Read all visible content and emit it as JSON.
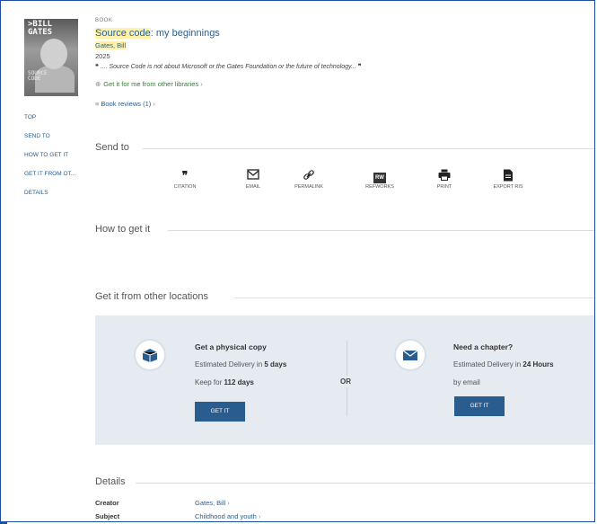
{
  "record": {
    "type": "BOOK",
    "title_hl": "Source code",
    "title_rest": ": my beginnings",
    "author": "Gates, Bill",
    "year": "2025",
    "quote_mark_open": "❝",
    "quote_text": ".... Source Code is not about Microsoft or the Gates Foundation or the future of technology...",
    "quote_mark_close": "❞",
    "get_it_link": "Get it for me from other libraries",
    "reviews_link": "Book reviews (1)",
    "chevron": "›",
    "cover_title": ">BILL\nGATES",
    "cover_subtitle": "SOURCE\nCODE"
  },
  "nav": {
    "items": [
      "TOP",
      "SEND TO",
      "HOW TO GET IT",
      "GET IT FROM OT...",
      "DETAILS"
    ]
  },
  "sections": {
    "send_to": "Send to",
    "how_to_get": "How to get it",
    "other_locations": "Get it from other locations",
    "details": "Details"
  },
  "actions": [
    {
      "label": "CITATION",
      "icon": "quote-icon",
      "glyph": "❞"
    },
    {
      "label": "EMAIL",
      "icon": "email-icon",
      "glyph": "✉"
    },
    {
      "label": "PERMALINK",
      "icon": "link-icon",
      "glyph": "🔗"
    },
    {
      "label": "REFWORKS",
      "icon": "refworks-icon",
      "glyph": "RW"
    },
    {
      "label": "PRINT",
      "icon": "print-icon",
      "glyph": "🖶"
    },
    {
      "label": "EXPORT RIS",
      "icon": "file-icon",
      "glyph": "📄"
    }
  ],
  "physical": {
    "title": "Get a physical copy",
    "delivery_prefix": "Estimated Delivery in",
    "delivery_value": "5 days",
    "keep_prefix": "Keep for",
    "keep_value": "112 days",
    "button": "GET IT"
  },
  "or_label": "OR",
  "chapter": {
    "title": "Need a chapter?",
    "delivery_prefix": "Estimated Delivery in",
    "delivery_value": "24 Hours",
    "by": "by email",
    "button": "GET IT"
  },
  "details": [
    {
      "label": "Creator",
      "value": "Gates, Bill"
    },
    {
      "label": "Subject",
      "value": "Childhood and youth"
    }
  ],
  "colors": {
    "link": "#2a5d8f",
    "panel": "#e6ebf1",
    "button": "#2a5d8f"
  }
}
